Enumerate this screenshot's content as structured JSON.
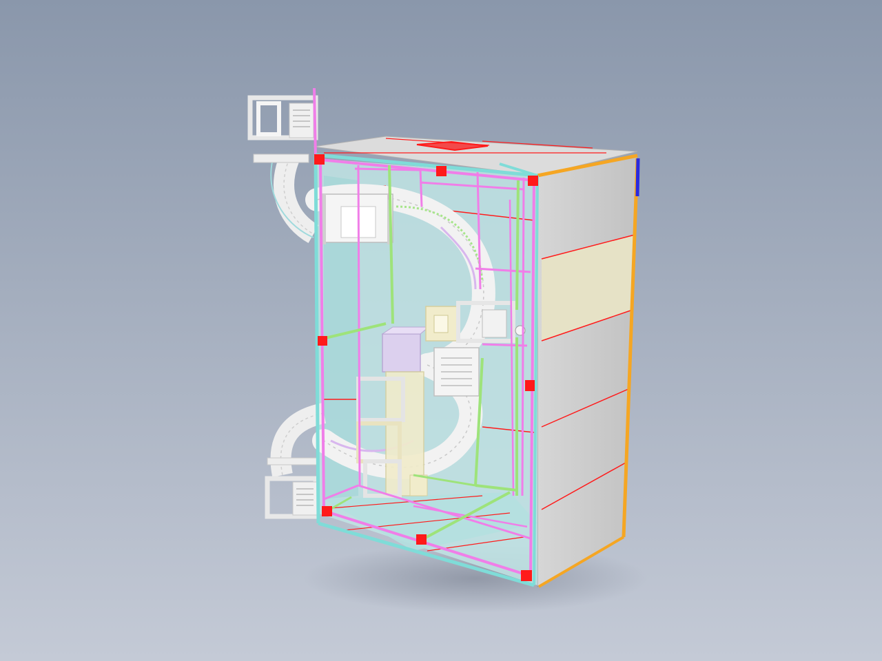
{
  "scene": {
    "background_top": "#8a97ab",
    "background_bottom": "#c4cad6",
    "palette": {
      "frame_magenta": "#f07ee8",
      "frame_green": "#9ee37a",
      "panel_cyan": "#7fdcd8",
      "corner_red": "#ff1a1a",
      "edge_orange": "#f5a623",
      "edge_blue": "#2a2adf",
      "panel_grey": "#d9d9d9",
      "panel_beige": "#e6e2c6",
      "interior_cyan": "#b9e3e3",
      "conveyor_white": "#f2f2f2",
      "module_lavender": "#dcd0ee",
      "module_cream": "#f1eccb"
    }
  }
}
